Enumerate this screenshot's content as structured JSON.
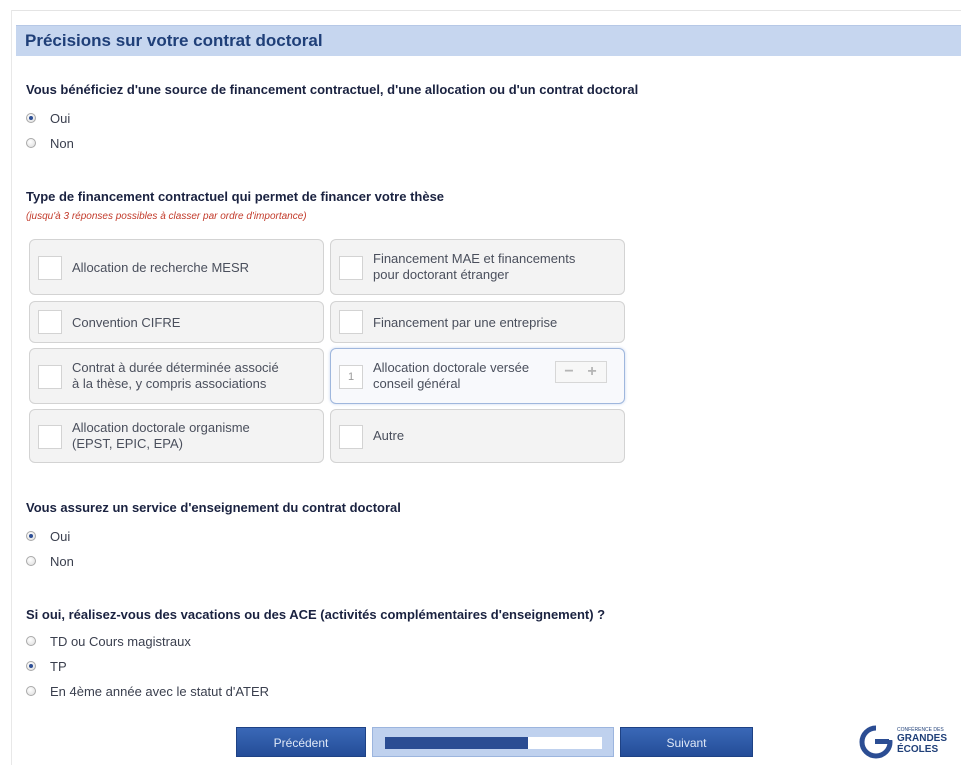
{
  "header": {
    "title": "Précisions sur votre contrat doctoral"
  },
  "q1": {
    "title": "Vous bénéficiez d'une source de financement contractuel, d'une allocation ou d'un contrat doctoral",
    "options": [
      {
        "label": "Oui",
        "checked": true
      },
      {
        "label": "Non",
        "checked": false
      }
    ]
  },
  "q2": {
    "title": "Type de financement contractuel qui permet de financer votre thèse",
    "hint": "(jusqu'à 3 réponses possibles à classer par ordre d'importance)",
    "choices": [
      {
        "line1": "Allocation de recherche MESR",
        "line2": "",
        "rank": ""
      },
      {
        "line1": "Financement MAE et financements",
        "line2": "pour doctorant étranger",
        "rank": ""
      },
      {
        "line1": "Convention CIFRE",
        "line2": "",
        "rank": ""
      },
      {
        "line1": "Financement par une entreprise",
        "line2": "",
        "rank": ""
      },
      {
        "line1": "Contrat à durée déterminée associé",
        "line2": "à la thèse, y compris associations",
        "rank": ""
      },
      {
        "line1": "Allocation doctorale versée",
        "line2": "conseil général",
        "rank": "1",
        "selected": true
      },
      {
        "line1": "Allocation doctorale organisme",
        "line2": "(EPST, EPIC, EPA)",
        "rank": ""
      },
      {
        "line1": "Autre",
        "line2": "",
        "rank": ""
      }
    ],
    "stepper": {
      "minus": "−",
      "plus": "+"
    }
  },
  "q3": {
    "title": "Vous assurez un service d'enseignement du contrat doctoral",
    "options": [
      {
        "label": "Oui",
        "checked": true
      },
      {
        "label": "Non",
        "checked": false
      }
    ]
  },
  "q4": {
    "title": "Si oui, réalisez-vous des vacations ou des ACE (activités complémentaires d'enseignement) ?",
    "options": [
      {
        "label": "TD ou Cours magistraux",
        "checked": false
      },
      {
        "label": "TP",
        "checked": true
      },
      {
        "label": "En 4ème année avec le statut d'ATER",
        "checked": false
      }
    ]
  },
  "nav": {
    "prev_label": "Précédent",
    "next_label": "Suivant",
    "progress": 0.66
  },
  "logo": {
    "line1": "CONFÉRENCE DES",
    "line2": "GRANDES",
    "line3": "ÉCOLES"
  },
  "colors": {
    "header_bg": "#c6d6ef",
    "title_blue": "#1f3f78",
    "button_blue": "#2b4d93",
    "hint_red": "#c23a2a"
  }
}
